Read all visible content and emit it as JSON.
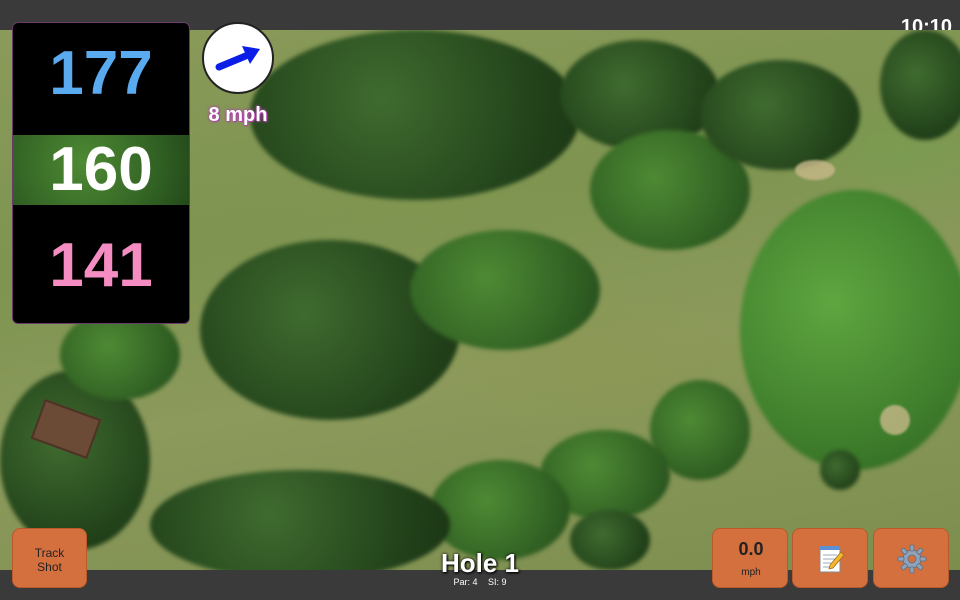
{
  "status": {
    "time": "10:10"
  },
  "distances": {
    "back": "177",
    "middle": "160",
    "front": "141"
  },
  "wind": {
    "speed": "8 mph",
    "icon": "wind-arrow-icon"
  },
  "hole": {
    "title": "Hole 1",
    "par": "Par: 4",
    "si": "SI: 9"
  },
  "buttons": {
    "track_line1": "Track",
    "track_line2": "Shot",
    "speed_value": "0.0",
    "speed_unit": "mph",
    "notes_icon": "notepad-icon",
    "settings_icon": "gear-icon"
  },
  "colors": {
    "accent": "#d4703e",
    "back_distance": "#5aaaf0",
    "middle_distance": "#ffffff",
    "front_distance": "#f58cc2",
    "wind_arrow": "#0a1ee8"
  }
}
